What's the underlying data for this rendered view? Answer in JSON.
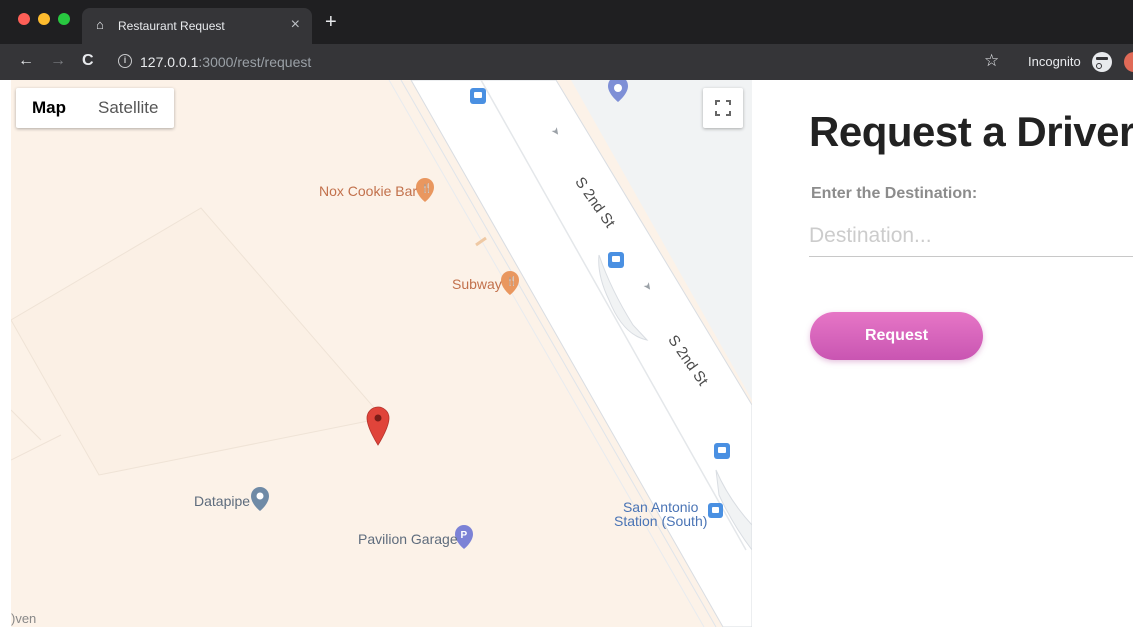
{
  "browser": {
    "tab_title": "Restaurant Request",
    "tab_icon": "home-icon",
    "url_host": "127.0.0.1",
    "url_rest": ":3000/rest/request",
    "incognito_label": "Incognito"
  },
  "map": {
    "type_controls": [
      "Map",
      "Satellite"
    ],
    "pois": {
      "nox_cookie_bar": "Nox Cookie Bar",
      "subway": "Subway",
      "datapipe": "Datapipe",
      "pavilion_garage": "Pavilion Garage",
      "san_antonio_line1": "San Antonio",
      "san_antonio_line2": "Station (South)"
    },
    "road_name_1": "S 2nd St",
    "road_name_2": "S 2nd St",
    "edge_text": ")ven"
  },
  "panel": {
    "title": "Request a Driver",
    "destination_label": "Enter the Destination:",
    "destination_placeholder": "Destination...",
    "destination_value": "",
    "request_label": "Request",
    "button_gradient": [
      "#e676c6",
      "#c955b2"
    ]
  }
}
